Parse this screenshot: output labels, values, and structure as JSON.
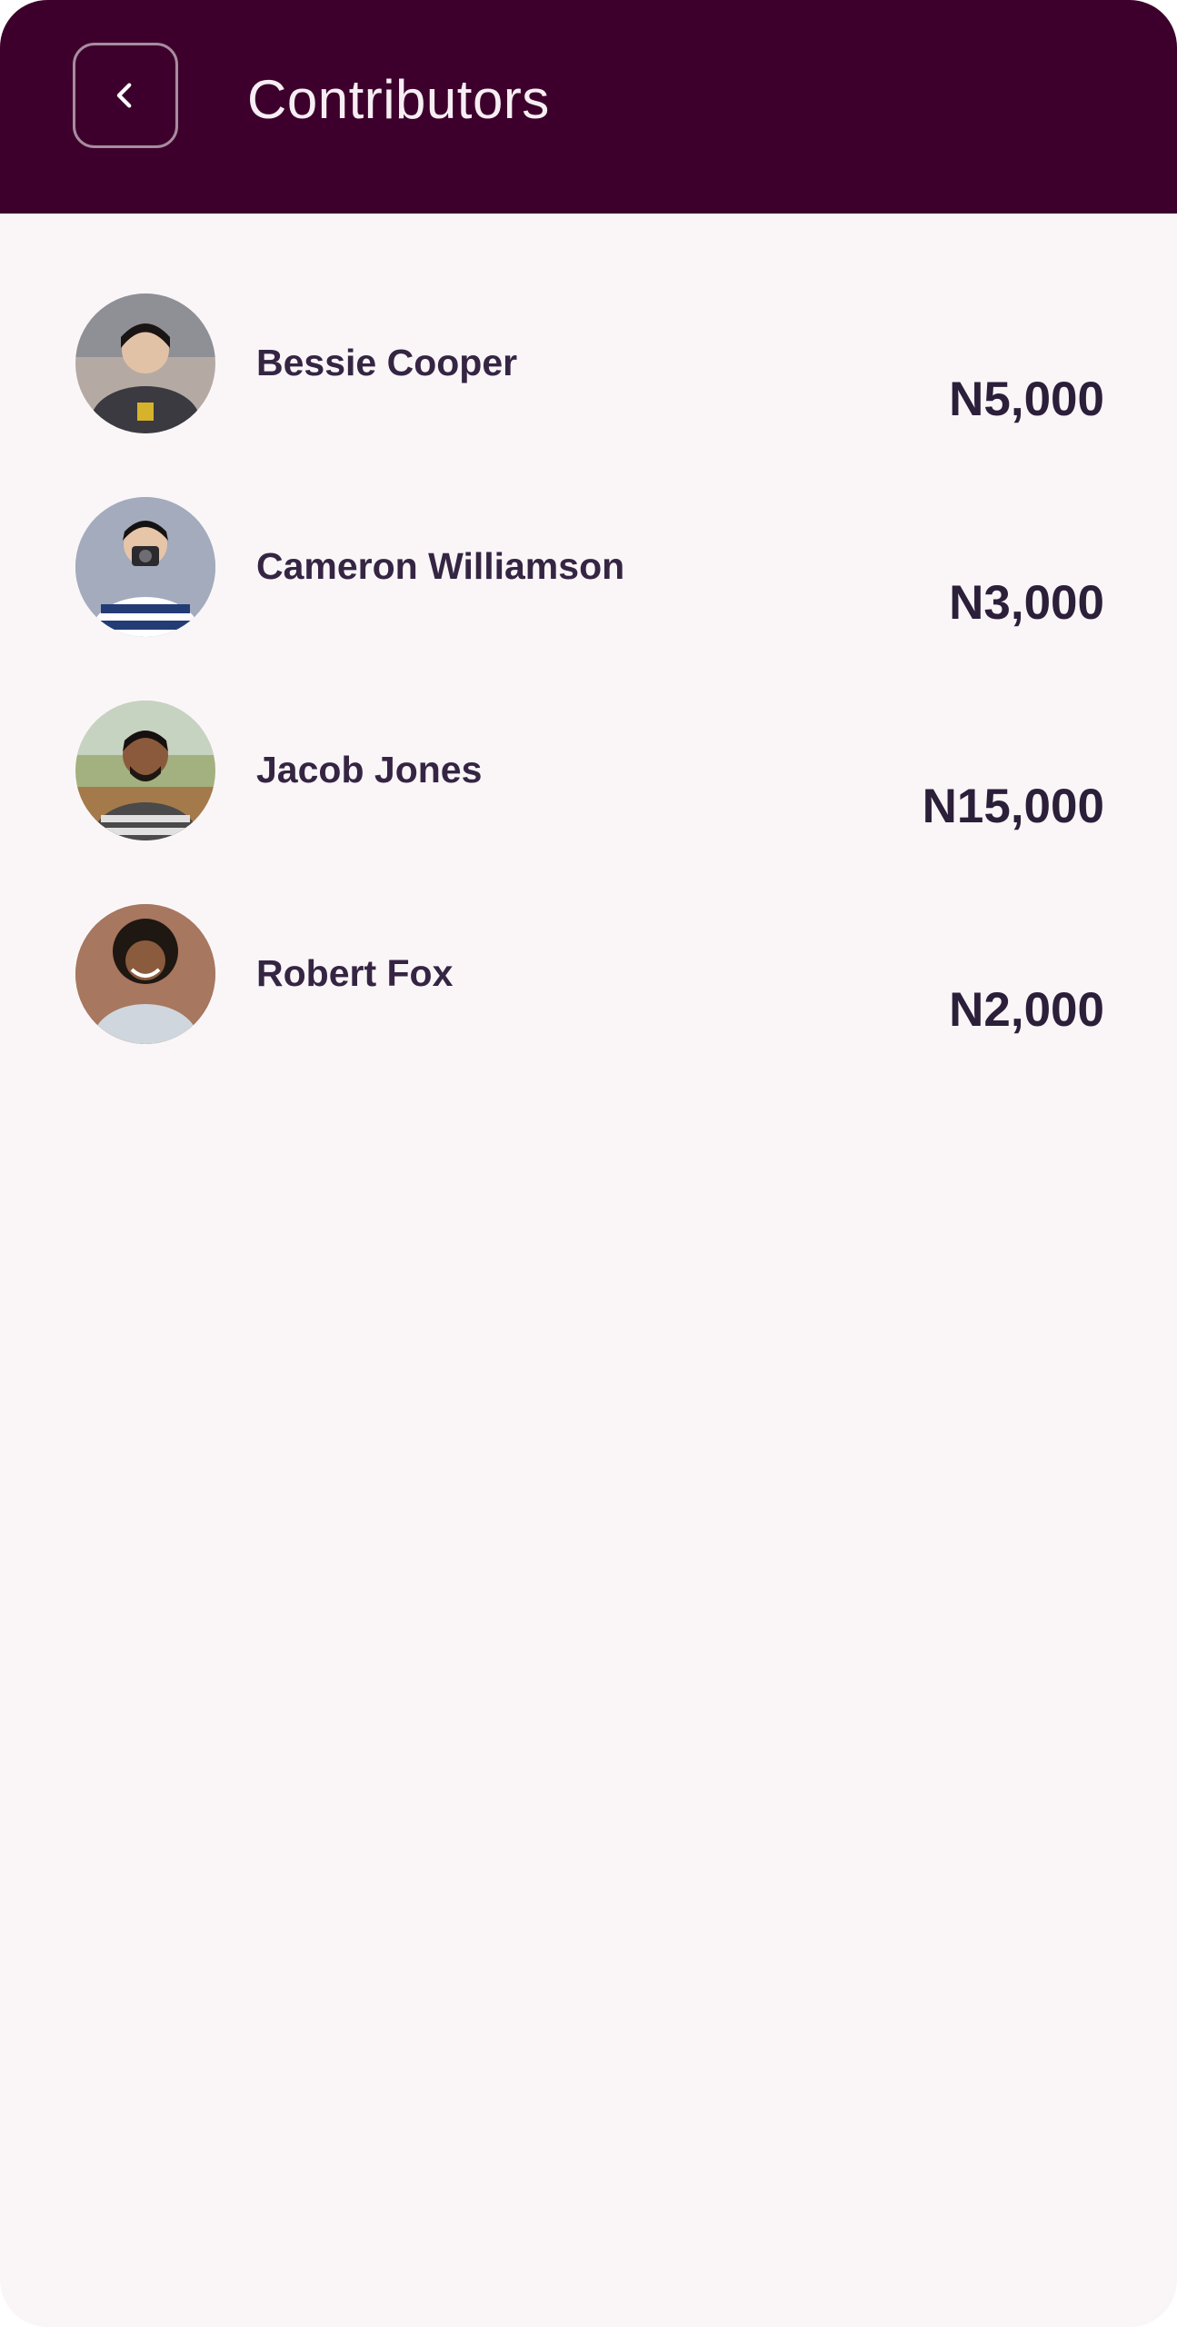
{
  "header": {
    "title": "Contributors",
    "back_icon": "chevron-left-icon",
    "background_color": "#3d002c"
  },
  "contributors": [
    {
      "name": "Bessie Cooper",
      "amount": "N5,000"
    },
    {
      "name": "Cameron Williamson",
      "amount": "N3,000"
    },
    {
      "name": "Jacob Jones",
      "amount": "N15,000"
    },
    {
      "name": "Robert Fox",
      "amount": "N2,000"
    }
  ]
}
